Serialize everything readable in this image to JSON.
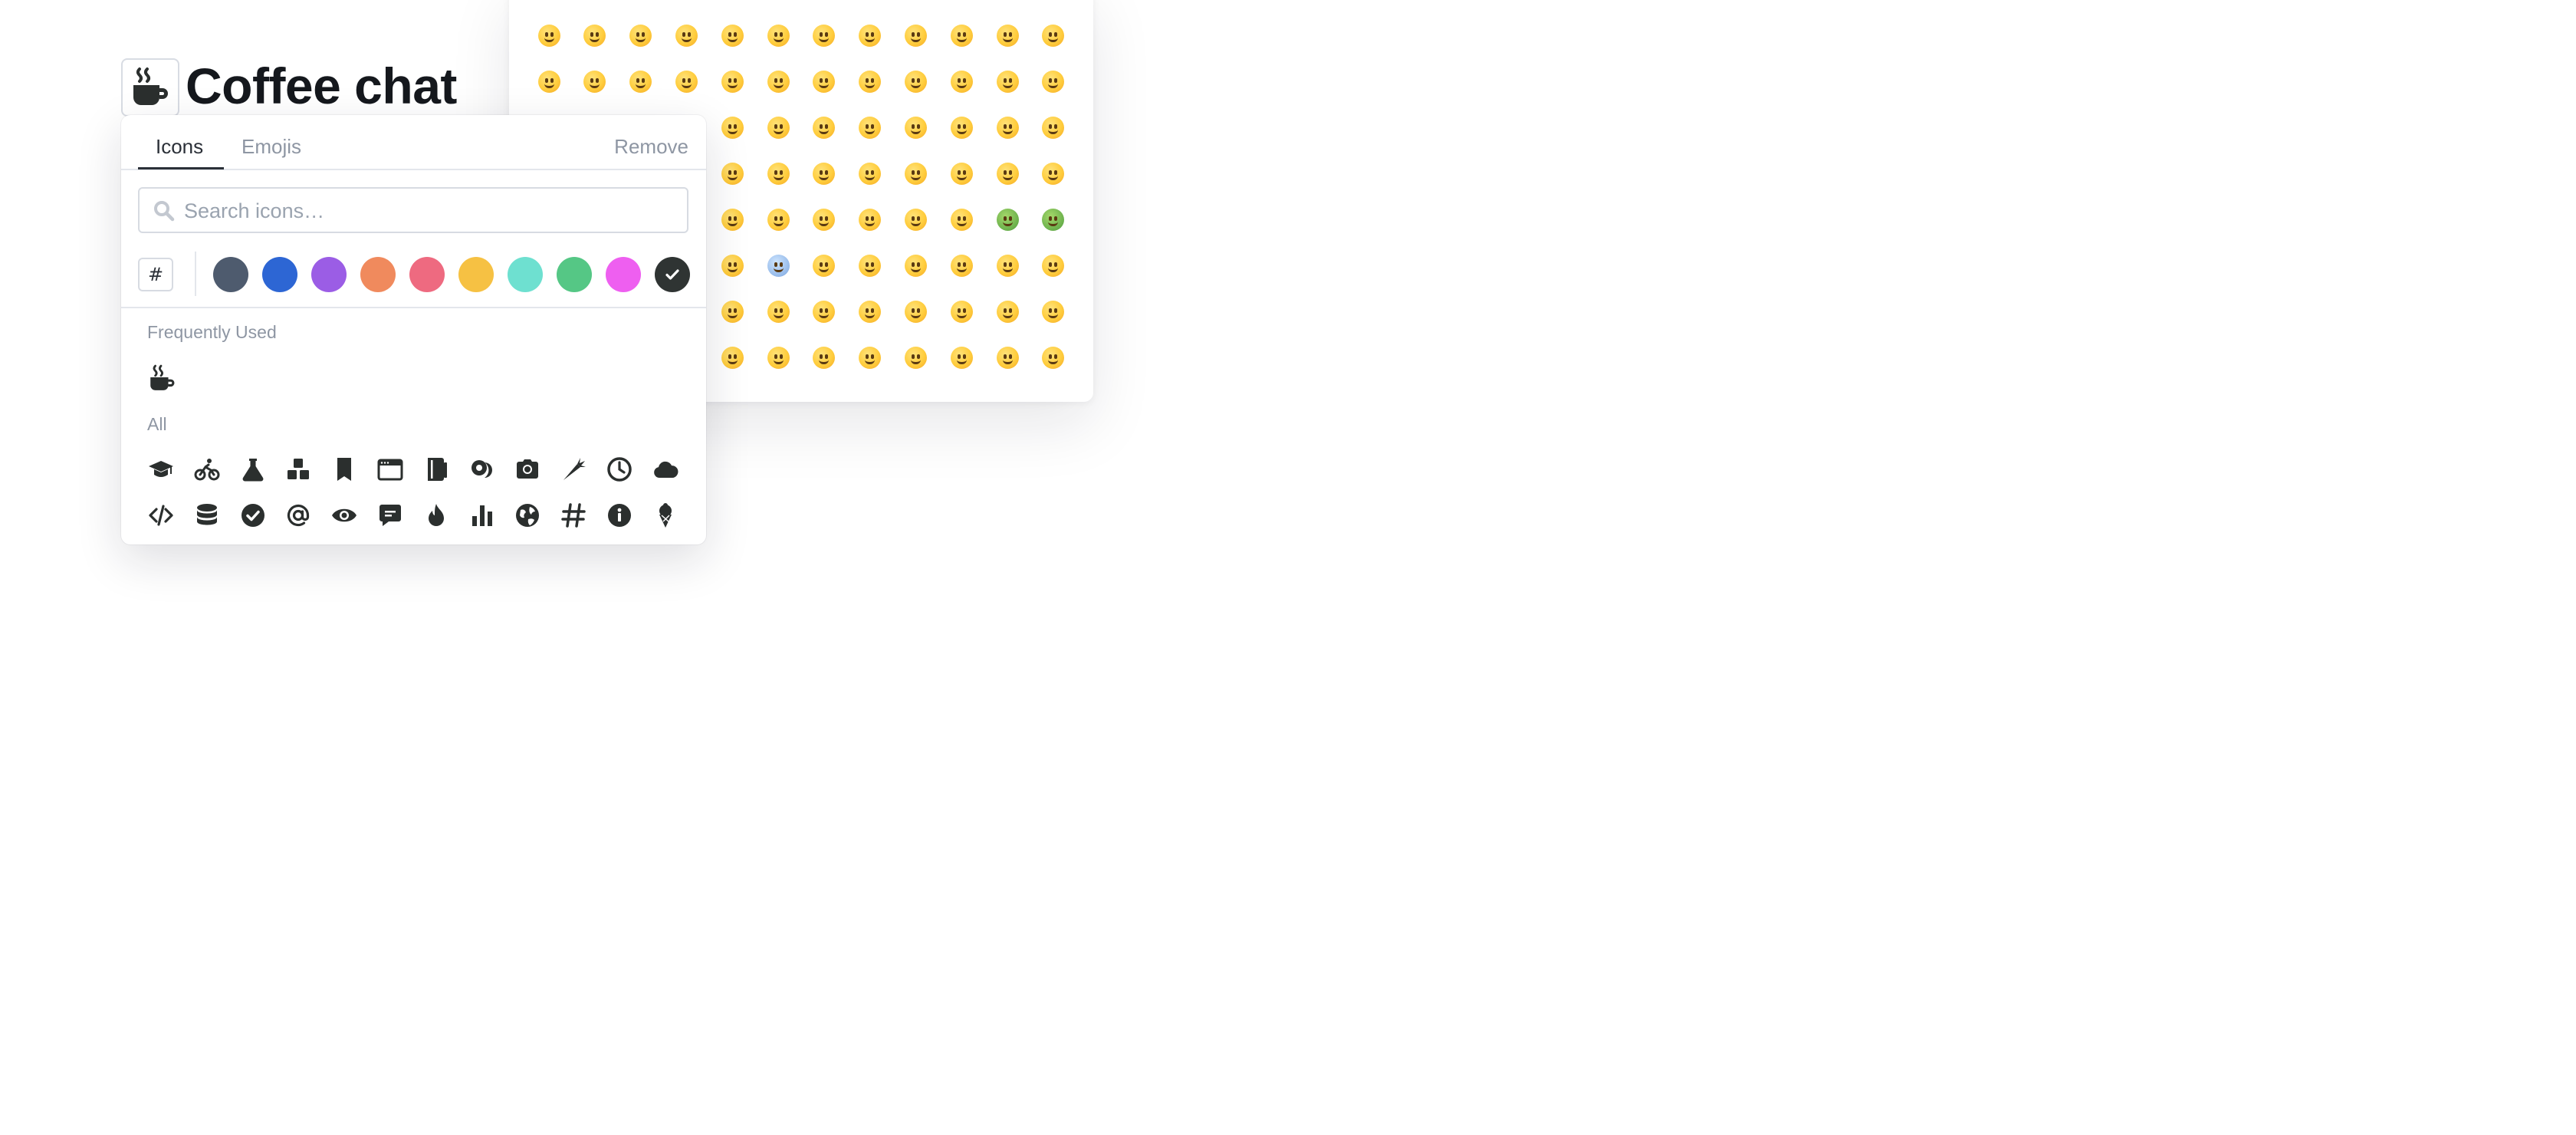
{
  "page": {
    "title": "Coffee chat",
    "title_icon": "mug-hot-icon"
  },
  "picker": {
    "tabs": [
      {
        "label": "Icons",
        "active": true
      },
      {
        "label": "Emojis",
        "active": false
      }
    ],
    "remove_label": "Remove",
    "search": {
      "placeholder": "Search icons…",
      "value": ""
    },
    "hash_label": "#",
    "colors": [
      "#4e5b6e",
      "#2d66d4",
      "#9b5de5",
      "#f08a5d",
      "#ee6a80",
      "#f6c143",
      "#6ee0d0",
      "#55c785",
      "#ee5ff0",
      "#2f3433"
    ],
    "selected_color_index": 9,
    "sections": {
      "frequent": {
        "label": "Frequently Used",
        "items": [
          "mug-hot-icon"
        ]
      },
      "all": {
        "label": "All",
        "items": [
          "graduation-cap-icon",
          "bicycle-icon",
          "flask-icon",
          "cubes-icon",
          "bookmark-icon",
          "browser-window-icon",
          "book-icon",
          "coins-icon",
          "camera-icon",
          "carrot-icon",
          "clock-icon",
          "cloud-icon",
          "code-icon",
          "database-icon",
          "check-circle-icon",
          "at-sign-icon",
          "eye-icon",
          "comment-icon",
          "fire-icon",
          "bar-chart-icon",
          "globe-icon",
          "hashtag-icon",
          "info-circle-icon",
          "ice-cream-icon"
        ]
      }
    }
  },
  "emoji_panel": {
    "rows": 8,
    "cols": 12,
    "partially_hidden": true
  }
}
